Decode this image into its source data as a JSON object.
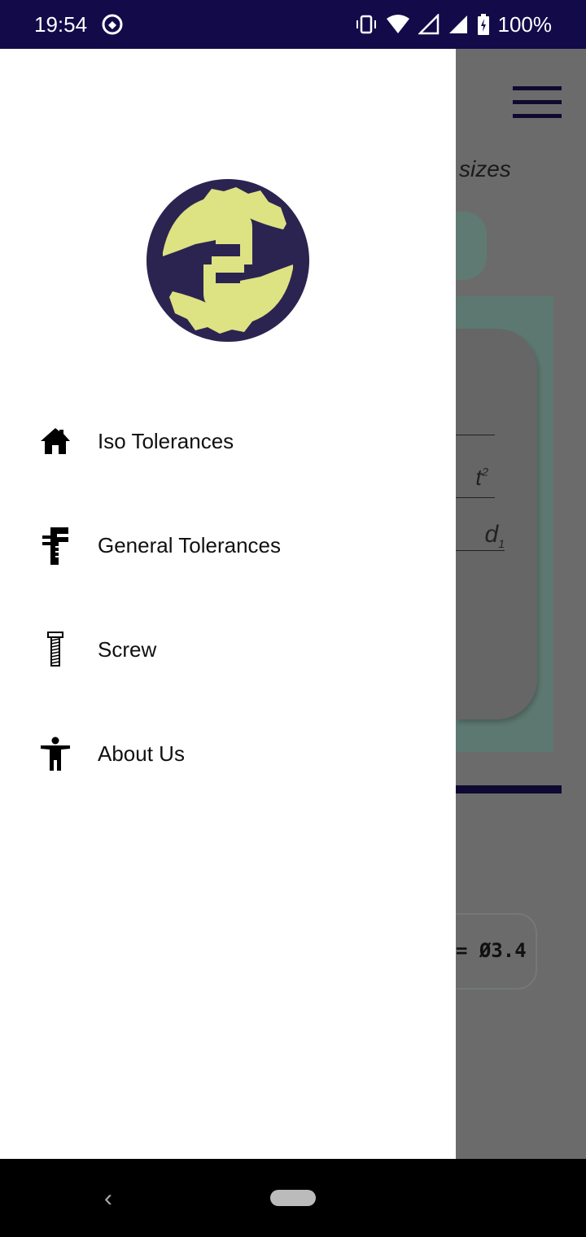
{
  "status_bar": {
    "time": "19:54",
    "battery": "100%",
    "icons": [
      "data-saver-icon",
      "vibrate-icon",
      "wifi-icon",
      "signal-icon",
      "signal-icon",
      "battery-charging-icon"
    ]
  },
  "background": {
    "subtitle_fragment": "sizes",
    "label_t2": "t",
    "label_t2_sub": "2",
    "label_d1": "d",
    "label_d1_sub": "1",
    "result_fragment": "= Ø3.4"
  },
  "drawer": {
    "items": [
      {
        "label": "Iso Tolerances",
        "icon": "home-icon"
      },
      {
        "label": "General Tolerances",
        "icon": "caliper-icon"
      },
      {
        "label": "Screw",
        "icon": "screw-icon"
      },
      {
        "label": "About Us",
        "icon": "person-icon"
      }
    ]
  },
  "colors": {
    "status_bar": "#130a4a",
    "logo_bg": "#2b2450",
    "logo_fg": "#dde283"
  }
}
